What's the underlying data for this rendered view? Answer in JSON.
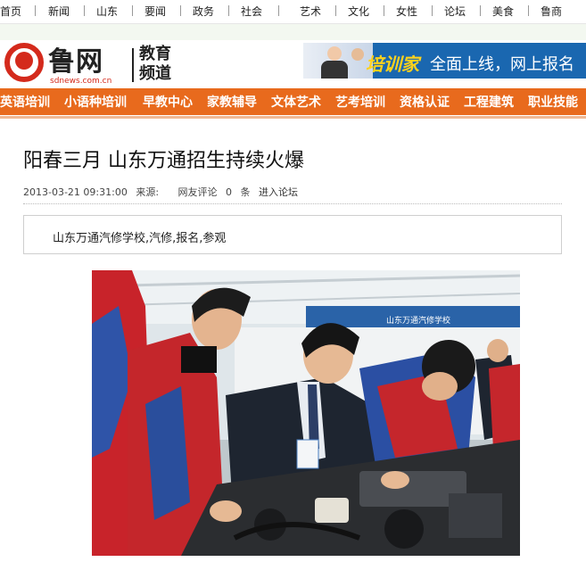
{
  "top_nav": [
    "首页",
    "新闻",
    "山东",
    "要闻",
    "政务",
    "社会",
    "艺术",
    "文化",
    "女性",
    "论坛",
    "美食",
    "鲁商"
  ],
  "logo": {
    "name": "鲁网",
    "domain": "sdnews.com.cn",
    "channel": "教育频道"
  },
  "banner": {
    "brand": "培训家",
    "text": "全面上线，网上报名"
  },
  "channel_nav": [
    "英语培训",
    "小语种培训",
    "早教中心",
    "家教辅导",
    "文体艺术",
    "艺考培训",
    "资格认证",
    "工程建筑",
    "职业技能"
  ],
  "article": {
    "title": "阳春三月 山东万通招生持续火爆",
    "datetime": "2013-03-21 09:31:00",
    "source_label": "来源:",
    "comment_label": "网友评论",
    "comment_count": "0",
    "comment_unit": "条",
    "forum_link": "进入论坛",
    "keywords": "山东万通汽修学校,汽修,报名,参观"
  },
  "photo": {
    "caption_board": "山东万通汽修学校"
  },
  "colors": {
    "nav_orange": "#e86a1d",
    "brand_red": "#d42a1c",
    "banner_blue": "#1a67b0",
    "banner_yellow": "#ffd21c"
  }
}
